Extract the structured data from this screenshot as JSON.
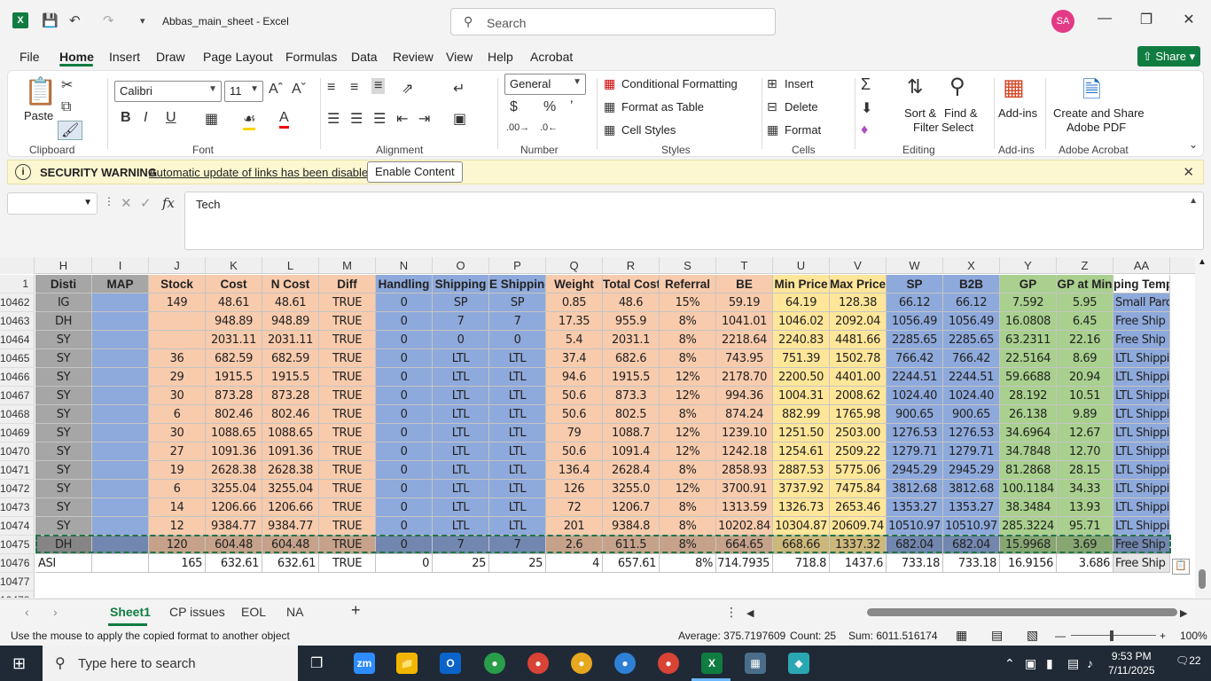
{
  "title": {
    "doc": "Abbas_main_sheet  -  Excel",
    "search_placeholder": "Search",
    "avatar": "SA"
  },
  "menu": [
    "File",
    "Home",
    "Insert",
    "Draw",
    "Page Layout",
    "Formulas",
    "Data",
    "Review",
    "View",
    "Help",
    "Acrobat"
  ],
  "share": "Share",
  "ribbon": {
    "clipboard": {
      "label": "Clipboard",
      "paste": "Paste"
    },
    "font": {
      "label": "Font",
      "name": "Calibri",
      "size": "11"
    },
    "alignment": {
      "label": "Alignment"
    },
    "number": {
      "label": "Number",
      "format": "General"
    },
    "styles": {
      "label": "Styles",
      "cond": "Conditional Formatting",
      "table": "Format as Table",
      "cell": "Cell Styles"
    },
    "cells": {
      "label": "Cells",
      "insert": "Insert",
      "delete": "Delete",
      "format": "Format"
    },
    "editing": {
      "label": "Editing",
      "sort": "Sort &",
      "filter": "Filter",
      "find": "Find &",
      "select": "Select"
    },
    "addins": {
      "label": "Add-ins",
      "btn": "Add-ins"
    },
    "acrobat": {
      "label": "Adobe Acrobat",
      "btn1": "Create and Share",
      "btn2": "Adobe PDF"
    }
  },
  "security": {
    "title": "SECURITY WARNING",
    "message": "Automatic update of links has been disabled",
    "button": "Enable Content"
  },
  "formula": {
    "value": "Tech",
    "fx": "fx"
  },
  "columns": [
    "H",
    "I",
    "J",
    "K",
    "L",
    "M",
    "N",
    "O",
    "P",
    "Q",
    "R",
    "S",
    "T",
    "U",
    "V",
    "W",
    "X",
    "Y",
    "Z",
    "AA"
  ],
  "header_row": {
    "num": "1",
    "cells": [
      "Disti",
      "MAP",
      "Stock",
      "Cost",
      "N Cost",
      "Diff",
      "Handling",
      "Shipping",
      "E Shipping",
      "Weight",
      "Total Cost",
      "Referral",
      "BE",
      "Min Price",
      "Max Price",
      "SP",
      "B2B",
      "GP",
      "GP at Min",
      "ping Template"
    ]
  },
  "rows": [
    {
      "num": "10462",
      "cells": [
        "IG",
        "",
        "149",
        "48.61",
        "48.61",
        "TRUE",
        "0",
        "SP",
        "SP",
        "0.85",
        "48.6",
        "15%",
        "59.19",
        "64.19",
        "128.38",
        "66.12",
        "66.12",
        "7.592",
        "5.95",
        "Small Parcel"
      ]
    },
    {
      "num": "10463",
      "cells": [
        "DH",
        "",
        "",
        "948.89",
        "948.89",
        "TRUE",
        "0",
        "7",
        "7",
        "17.35",
        "955.9",
        "8%",
        "1041.01",
        "1046.02",
        "2092.04",
        "1056.49",
        "1056.49",
        "16.0808",
        "6.45",
        "Free Ship (BuyBo"
      ]
    },
    {
      "num": "10464",
      "cells": [
        "SY",
        "",
        "",
        "2031.11",
        "2031.11",
        "TRUE",
        "0",
        "0",
        "0",
        "5.4",
        "2031.1",
        "8%",
        "2218.64",
        "2240.83",
        "4481.66",
        "2285.65",
        "2285.65",
        "63.2311",
        "22.16",
        "Free Ship (BuyBo"
      ]
    },
    {
      "num": "10465",
      "cells": [
        "SY",
        "",
        "36",
        "682.59",
        "682.59",
        "TRUE",
        "0",
        "LTL",
        "LTL",
        "37.4",
        "682.6",
        "8%",
        "743.95",
        "751.39",
        "1502.78",
        "766.42",
        "766.42",
        "22.5164",
        "8.69",
        "LTL Shipping"
      ]
    },
    {
      "num": "10466",
      "cells": [
        "SY",
        "",
        "29",
        "1915.5",
        "1915.5",
        "TRUE",
        "0",
        "LTL",
        "LTL",
        "94.6",
        "1915.5",
        "12%",
        "2178.70",
        "2200.50",
        "4401.00",
        "2244.51",
        "2244.51",
        "59.6688",
        "20.94",
        "LTL Shipping"
      ]
    },
    {
      "num": "10467",
      "cells": [
        "SY",
        "",
        "30",
        "873.28",
        "873.28",
        "TRUE",
        "0",
        "LTL",
        "LTL",
        "50.6",
        "873.3",
        "12%",
        "994.36",
        "1004.31",
        "2008.62",
        "1024.40",
        "1024.40",
        "28.192",
        "10.51",
        "LTL Shipping"
      ]
    },
    {
      "num": "10468",
      "cells": [
        "SY",
        "",
        "6",
        "802.46",
        "802.46",
        "TRUE",
        "0",
        "LTL",
        "LTL",
        "50.6",
        "802.5",
        "8%",
        "874.24",
        "882.99",
        "1765.98",
        "900.65",
        "900.65",
        "26.138",
        "9.89",
        "LTL Shipping"
      ]
    },
    {
      "num": "10469",
      "cells": [
        "SY",
        "",
        "30",
        "1088.65",
        "1088.65",
        "TRUE",
        "0",
        "LTL",
        "LTL",
        "79",
        "1088.7",
        "12%",
        "1239.10",
        "1251.50",
        "2503.00",
        "1276.53",
        "1276.53",
        "34.6964",
        "12.67",
        "LTL Shipping"
      ]
    },
    {
      "num": "10470",
      "cells": [
        "SY",
        "",
        "27",
        "1091.36",
        "1091.36",
        "TRUE",
        "0",
        "LTL",
        "LTL",
        "50.6",
        "1091.4",
        "12%",
        "1242.18",
        "1254.61",
        "2509.22",
        "1279.71",
        "1279.71",
        "34.7848",
        "12.70",
        "LTL Shipping"
      ]
    },
    {
      "num": "10471",
      "cells": [
        "SY",
        "",
        "19",
        "2628.38",
        "2628.38",
        "TRUE",
        "0",
        "LTL",
        "LTL",
        "136.4",
        "2628.4",
        "8%",
        "2858.93",
        "2887.53",
        "5775.06",
        "2945.29",
        "2945.29",
        "81.2868",
        "28.15",
        "LTL Shipping"
      ]
    },
    {
      "num": "10472",
      "cells": [
        "SY",
        "",
        "6",
        "3255.04",
        "3255.04",
        "TRUE",
        "0",
        "LTL",
        "LTL",
        "126",
        "3255.0",
        "12%",
        "3700.91",
        "3737.92",
        "7475.84",
        "3812.68",
        "3812.68",
        "100.1184",
        "34.33",
        "LTL Shipping"
      ]
    },
    {
      "num": "10473",
      "cells": [
        "SY",
        "",
        "14",
        "1206.66",
        "1206.66",
        "TRUE",
        "0",
        "LTL",
        "LTL",
        "72",
        "1206.7",
        "8%",
        "1313.59",
        "1326.73",
        "2653.46",
        "1353.27",
        "1353.27",
        "38.3484",
        "13.93",
        "LTL Shipping"
      ]
    },
    {
      "num": "10474",
      "cells": [
        "SY",
        "",
        "12",
        "9384.77",
        "9384.77",
        "TRUE",
        "0",
        "LTL",
        "LTL",
        "201",
        "9384.8",
        "8%",
        "10202.84",
        "10304.87",
        "20609.74",
        "10510.97",
        "10510.97",
        "285.3224",
        "95.71",
        "LTL Shipping"
      ]
    },
    {
      "num": "10475",
      "cells": [
        "DH",
        "",
        "120",
        "604.48",
        "604.48",
        "TRUE",
        "0",
        "7",
        "7",
        "2.6",
        "611.5",
        "8%",
        "664.65",
        "668.66",
        "1337.32",
        "682.04",
        "682.04",
        "15.9968",
        "3.69",
        "Free Ship (BuyBo"
      ]
    }
  ],
  "plain_row": {
    "num": "10476",
    "cells": [
      "ASI",
      "",
      "165",
      "632.61",
      "632.61",
      "TRUE",
      "0",
      "25",
      "25",
      "4",
      "657.61",
      "8%",
      "714.7935",
      "718.8",
      "1437.6",
      "733.18",
      "733.18",
      "16.9156",
      "3.686",
      "Free Ship (Bu"
    ]
  },
  "empty_rows": [
    "10477",
    "10478"
  ],
  "colors": {
    "gray": "#a6a6a6",
    "blue": "#8ea9db",
    "peach": "#f8cbad",
    "yellow": "#ffe699",
    "green": "#a9d08e",
    "accent": "#107c41"
  },
  "sheets": [
    "Sheet1",
    "CP issues",
    "EOL",
    "NA"
  ],
  "status": {
    "hint": "Use the mouse to apply the copied format to another object",
    "average": "Average: 375.7197609",
    "count": "Count: 25",
    "sum": "Sum: 6011.516174",
    "zoom": "100%"
  },
  "taskbar": {
    "search": "Type here to search",
    "time": "9:53 PM",
    "date": "7/11/2025",
    "notif": "22"
  }
}
